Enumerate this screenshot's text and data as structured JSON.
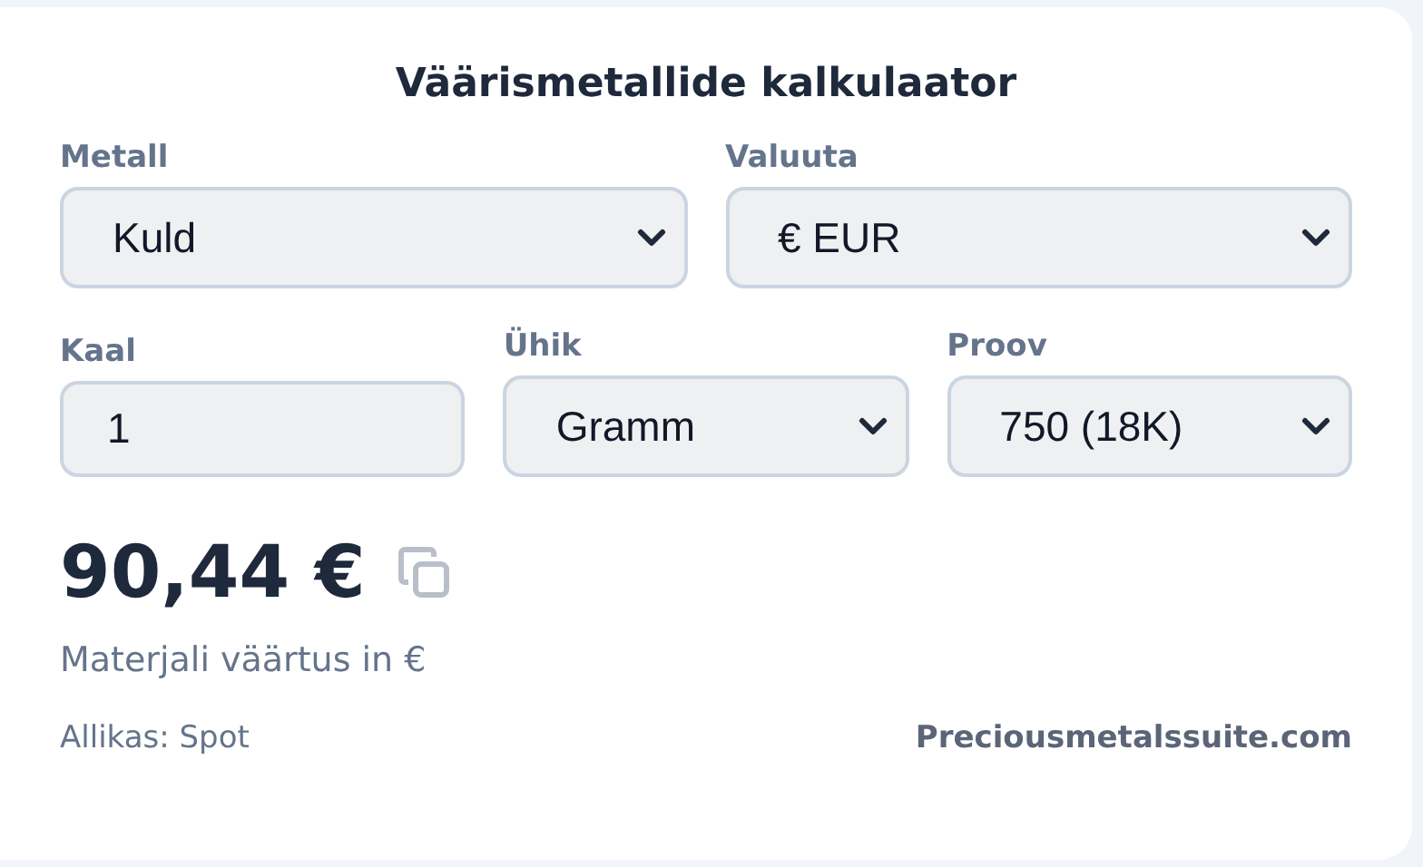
{
  "title": "Väärismetallide kalkulaator",
  "rows": [
    [
      {
        "kind": "select",
        "label": "Metall",
        "value": "Kuld"
      },
      {
        "kind": "select",
        "label": "Valuuta",
        "value": "€ EUR"
      }
    ],
    [
      {
        "kind": "input",
        "label": "Kaal",
        "value": "1"
      },
      {
        "kind": "select",
        "label": "Ühik",
        "value": "Gramm"
      },
      {
        "kind": "select",
        "label": "Proov",
        "value": "750 (18K)"
      }
    ]
  ],
  "result": {
    "value": "90,44 €",
    "caption": "Materjali väärtus in €"
  },
  "footer": {
    "source": "Allikas: Spot",
    "link": "Preciousmetalssuite.com"
  }
}
